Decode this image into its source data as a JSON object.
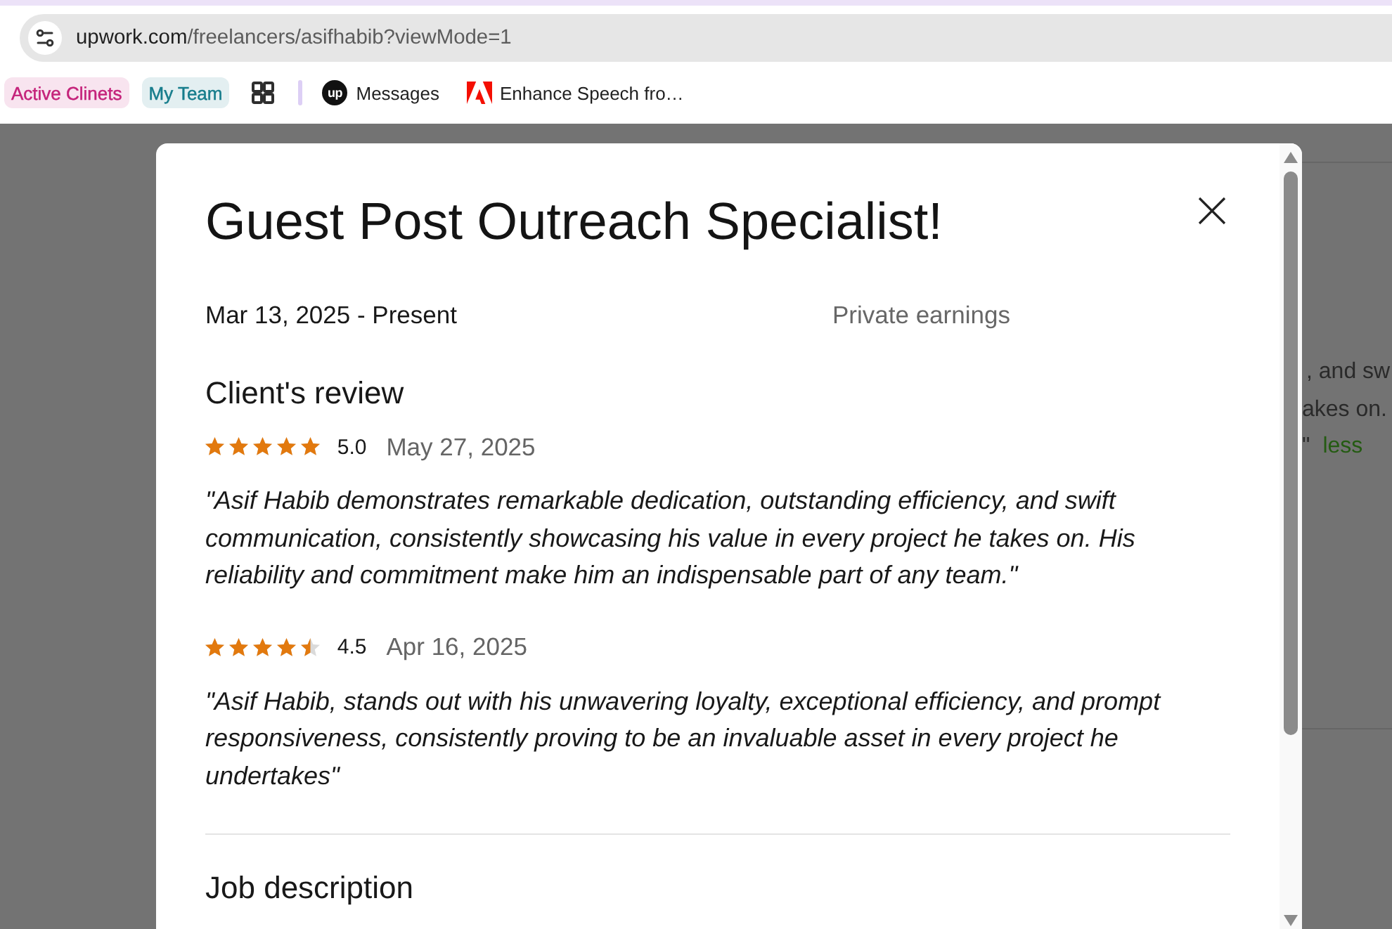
{
  "browser": {
    "address_bar": {
      "domain": "upwork.com",
      "path": "/freelancers/asifhabib?viewMode=1"
    },
    "bookmarks": [
      {
        "kind": "group",
        "label": "Active Clinets",
        "color": "#c4227a"
      },
      {
        "kind": "group",
        "label": "My Team",
        "color": "#177d8c"
      },
      {
        "kind": "apps"
      },
      {
        "kind": "divider"
      },
      {
        "kind": "badge-link",
        "badge": "up",
        "label": "Messages"
      },
      {
        "kind": "mark-link",
        "label": "Enhance Speech fro…"
      }
    ]
  },
  "background_page": {
    "lines": [
      {
        "text": ", and sw"
      },
      {
        "text": "akes on."
      },
      {
        "text": "\"",
        "link": "less"
      }
    ]
  },
  "dialog": {
    "title": "Guest Post Outreach Specialist!",
    "period": "Mar 13, 2025 - Present",
    "earnings": "Private earnings",
    "review_heading": "Client's review",
    "reviews": [
      {
        "stars": 5,
        "rating": "5.0",
        "date": "May 27, 2025",
        "text": "\"Asif Habib demonstrates remarkable dedication, outstanding efficiency, and swift communication, consistently showcasing his value in every project he takes on. His reliability and commitment make him an indispensable part of any team.\""
      },
      {
        "stars": 4.5,
        "rating": "4.5",
        "date": "Apr 16, 2025",
        "text": "\"Asif Habib, stands out with his unwavering loyalty, exceptional efficiency, and prompt responsiveness, consistently proving to be an invaluable asset in every project he undertakes\""
      }
    ],
    "section_heading": "Job description"
  }
}
